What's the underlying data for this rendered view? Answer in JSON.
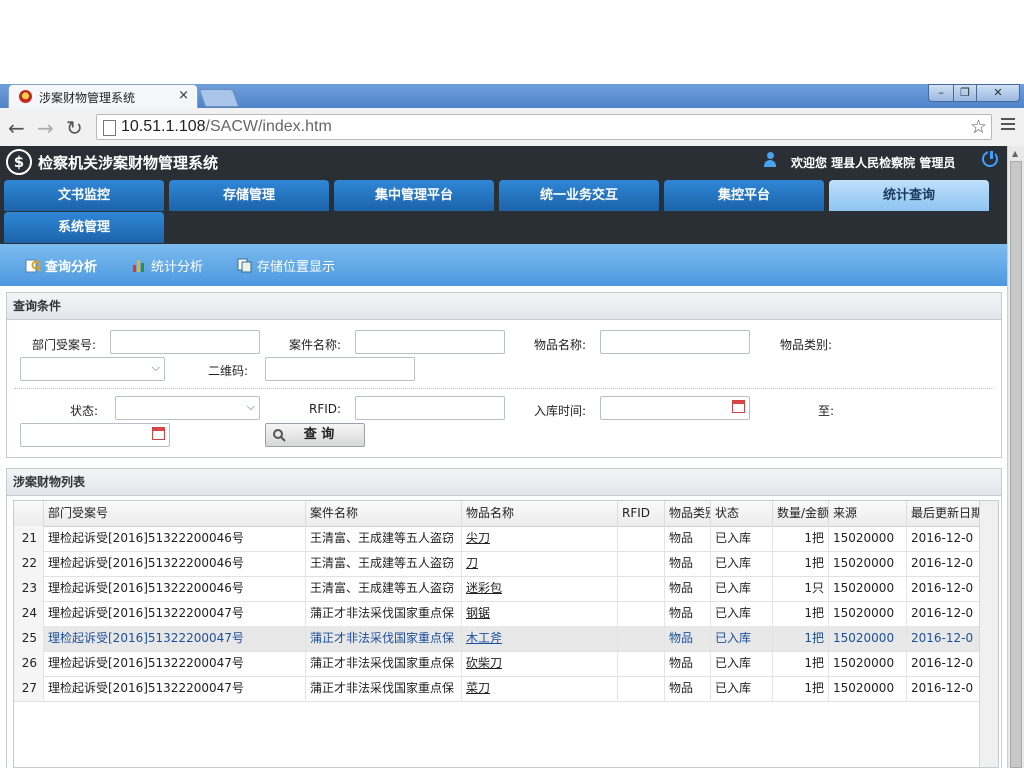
{
  "browser": {
    "tab_title": "涉案财物管理系统",
    "tab_close": "×",
    "url_host": "10.51.1.108",
    "url_path": "/SACW/index.htm",
    "win_min": "–",
    "win_max": "❐",
    "win_close": "✕"
  },
  "app": {
    "title": "检察机关涉案财物管理系统",
    "welcome": "欢迎您  理县人民检察院 管理员",
    "menu": [
      "文书监控",
      "存储管理",
      "集中管理平台",
      "统一业务交互",
      "集控平台",
      "统计查询",
      "系统管理"
    ],
    "active_menu": "统计查询",
    "subnav": [
      "查询分析",
      "统计分析",
      "存储位置显示"
    ]
  },
  "query": {
    "title": "查询条件",
    "labels": {
      "case_no": "部门受案号:",
      "case_name": "案件名称:",
      "item_name": "物品名称:",
      "item_type": "物品类别:",
      "qrcode": "二维码:",
      "status": "状态:",
      "rfid": "RFID:",
      "in_time": "入库时间:",
      "to": "至:"
    },
    "button": "查 询"
  },
  "list": {
    "title": "涉案财物列表",
    "columns": [
      "部门受案号",
      "案件名称",
      "物品名称",
      "RFID",
      "物品类别",
      "状态",
      "数量/金额",
      "来源",
      "最后更新日期"
    ],
    "rows": [
      {
        "n": "21",
        "case_no": "理检起诉受[2016]51322200046号",
        "case_name": "王清富、王成建等五人盗窃",
        "item": "尖刀",
        "rfid": "",
        "type": "物品",
        "status": "已入库",
        "qty": "1把",
        "source": "15020000",
        "date": "2016-12-0"
      },
      {
        "n": "22",
        "case_no": "理检起诉受[2016]51322200046号",
        "case_name": "王清富、王成建等五人盗窃",
        "item": "刀",
        "rfid": "",
        "type": "物品",
        "status": "已入库",
        "qty": "1把",
        "source": "15020000",
        "date": "2016-12-0"
      },
      {
        "n": "23",
        "case_no": "理检起诉受[2016]51322200046号",
        "case_name": "王清富、王成建等五人盗窃",
        "item": "迷彩包",
        "rfid": "",
        "type": "物品",
        "status": "已入库",
        "qty": "1只",
        "source": "15020000",
        "date": "2016-12-0"
      },
      {
        "n": "24",
        "case_no": "理检起诉受[2016]51322200047号",
        "case_name": "蒲正才非法采伐国家重点保",
        "item": "钢锯",
        "rfid": "",
        "type": "物品",
        "status": "已入库",
        "qty": "1把",
        "source": "15020000",
        "date": "2016-12-0"
      },
      {
        "n": "25",
        "case_no": "理检起诉受[2016]51322200047号",
        "case_name": "蒲正才非法采伐国家重点保",
        "item": "木工斧",
        "rfid": "",
        "type": "物品",
        "status": "已入库",
        "qty": "1把",
        "source": "15020000",
        "date": "2016-12-0"
      },
      {
        "n": "26",
        "case_no": "理检起诉受[2016]51322200047号",
        "case_name": "蒲正才非法采伐国家重点保",
        "item": "砍柴刀",
        "rfid": "",
        "type": "物品",
        "status": "已入库",
        "qty": "1把",
        "source": "15020000",
        "date": "2016-12-0"
      },
      {
        "n": "27",
        "case_no": "理检起诉受[2016]51322200047号",
        "case_name": "蒲正才非法采伐国家重点保",
        "item": "菜刀",
        "rfid": "",
        "type": "物品",
        "status": "已入库",
        "qty": "1把",
        "source": "15020000",
        "date": "2016-12-0"
      }
    ],
    "highlighted_row": "25"
  },
  "colors": {
    "header_bg": "#2a2f35",
    "menu_blue": "#1c63aa",
    "menu_active": "#8ec4f2",
    "subnav_blue": "#4c98de"
  }
}
